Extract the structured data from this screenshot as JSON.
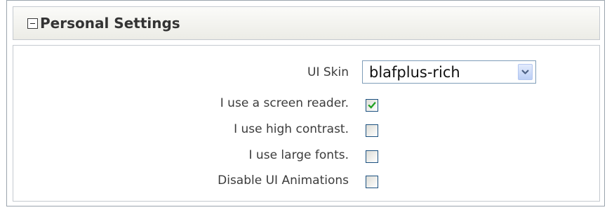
{
  "panel": {
    "title": "Personal Settings",
    "collapse_icon": "minus-square-icon"
  },
  "settings": {
    "ui_skin": {
      "label": "UI Skin",
      "value": "blafplus-rich",
      "dropdown_icon": "chevron-down-icon"
    },
    "screen_reader": {
      "label": "I use a screen reader.",
      "checked": true
    },
    "high_contrast": {
      "label": "I use high contrast.",
      "checked": false
    },
    "large_fonts": {
      "label": "I use large fonts.",
      "checked": false
    },
    "disable_animations": {
      "label": "Disable UI Animations",
      "checked": false
    }
  },
  "colors": {
    "checkmark": "#21a121",
    "checkbox_border": "#1c5180",
    "select_border": "#7f9db9",
    "dropdown_arrow": "#4d6185"
  }
}
